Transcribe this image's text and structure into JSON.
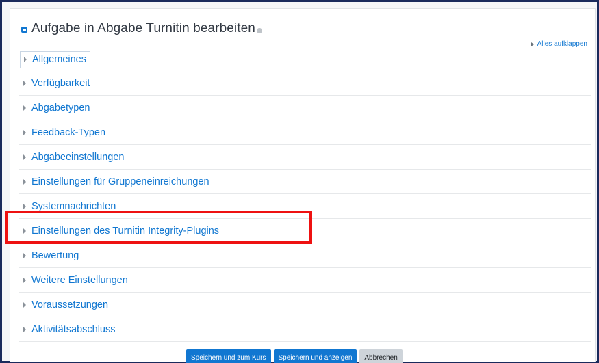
{
  "page": {
    "title": "Aufgabe in Abgabe Turnitin bearbeiten",
    "expand_all_label": "Alles aufklappen"
  },
  "sections": [
    {
      "label": "Allgemeines"
    },
    {
      "label": "Verfügbarkeit"
    },
    {
      "label": "Abgabetypen"
    },
    {
      "label": "Feedback-Typen"
    },
    {
      "label": "Abgabeeinstellungen"
    },
    {
      "label": "Einstellungen für Gruppeneinreichungen"
    },
    {
      "label": "Systemnachrichten"
    },
    {
      "label": "Einstellungen des Turnitin Integrity-Plugins"
    },
    {
      "label": "Bewertung"
    },
    {
      "label": "Weitere Einstellungen"
    },
    {
      "label": "Voraussetzungen"
    },
    {
      "label": "Aktivitätsabschluss"
    }
  ],
  "buttons": {
    "save_return": "Speichern und zum Kurs",
    "save_display": "Speichern und anzeigen",
    "cancel": "Abbrechen"
  },
  "colors": {
    "link": "#1177d1",
    "primary_button": "#1177d1",
    "highlight_box": "#ee1111",
    "frame_border": "#1a2a5c"
  },
  "icons": {
    "module": "assignment-icon",
    "help": "help-icon",
    "collapsed": "chevron-right-icon"
  }
}
